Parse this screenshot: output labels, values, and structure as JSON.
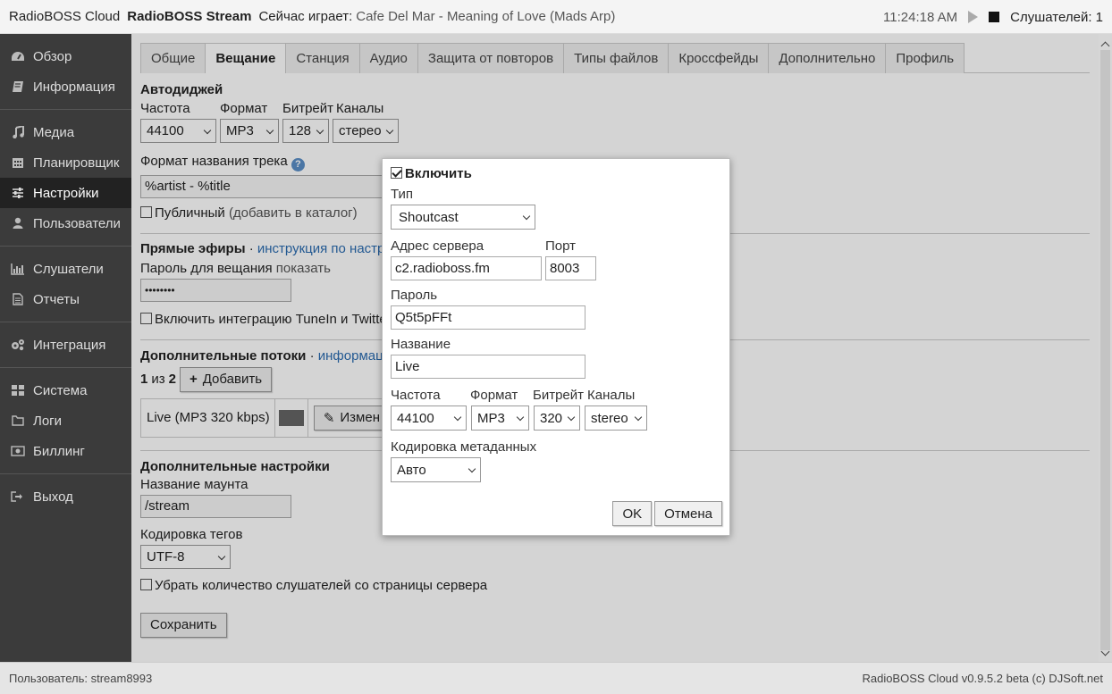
{
  "topbar": {
    "app_name": "RadioBOSS Cloud",
    "station_name": "RadioBOSS Stream",
    "now_playing_label": "Сейчас играет:",
    "now_playing_title": "Cafe Del Mar - Meaning of Love (Mads Arp)",
    "clock": "11:24:18 AM",
    "listeners": "Слушателей: 1"
  },
  "sidebar": {
    "items": [
      {
        "label": "Обзор",
        "icon": "dashboard-icon"
      },
      {
        "label": "Информация",
        "icon": "book-icon"
      },
      {
        "label": "Медиа",
        "icon": "music-icon"
      },
      {
        "label": "Планировщик",
        "icon": "calendar-icon"
      },
      {
        "label": "Настройки",
        "icon": "sliders-icon"
      },
      {
        "label": "Пользователи",
        "icon": "user-icon"
      },
      {
        "label": "Слушатели",
        "icon": "bar-chart-icon"
      },
      {
        "label": "Отчеты",
        "icon": "document-icon"
      },
      {
        "label": "Интеграция",
        "icon": "gears-icon"
      },
      {
        "label": "Система",
        "icon": "grid-icon"
      },
      {
        "label": "Логи",
        "icon": "folder-icon"
      },
      {
        "label": "Биллинг",
        "icon": "money-icon"
      },
      {
        "label": "Выход",
        "icon": "logout-icon"
      }
    ],
    "active": "Настройки"
  },
  "tabs": [
    "Общие",
    "Вещание",
    "Станция",
    "Аудио",
    "Защита от повторов",
    "Типы файлов",
    "Кроссфейды",
    "Дополнительно",
    "Профиль"
  ],
  "active_tab": "Вещание",
  "autodj": {
    "title": "Автодиджей",
    "freq_label": "Частота",
    "format_label": "Формат",
    "bitrate_label": "Битрейт",
    "channels_label": "Каналы",
    "freq": "44100",
    "format": "MP3",
    "bitrate": "128",
    "channels": "стерео",
    "track_format_label": "Формат названия трека",
    "track_format": "%artist - %title",
    "public_label": "Публичный",
    "public_hint": "(добавить в каталог)"
  },
  "live": {
    "title": "Прямые эфиры",
    "link": "инструкция по настро",
    "password_label": "Пароль для вещания",
    "show_label": "показать",
    "password": "••••••••",
    "tunein_label": "Включить интеграцию TuneIn и Twitte"
  },
  "streams": {
    "title": "Дополнительные потоки",
    "link": "информация",
    "count_current": "1",
    "count_of": "из",
    "count_total": "2",
    "add_label": "Добавить",
    "stream_name": "Live (MP3 320 kbps)",
    "edit_label": "Измен"
  },
  "extra": {
    "title": "Дополнительные настройки",
    "mount_label": "Название маунта",
    "mount": "/stream",
    "encoding_label": "Кодировка тегов",
    "encoding": "UTF-8",
    "hide_listeners_label": "Убрать количество слушателей со страницы сервера",
    "save_label": "Сохранить"
  },
  "dialog": {
    "enable_label": "Включить",
    "type_label": "Тип",
    "type": "Shoutcast",
    "server_label": "Адрес сервера",
    "server": "c2.radioboss.fm",
    "port_label": "Порт",
    "port": "8003",
    "password_label": "Пароль",
    "password": "Q5t5pFFt",
    "name_label": "Название",
    "name": "Live",
    "freq_label": "Частота",
    "format_label": "Формат",
    "bitrate_label": "Битрейт",
    "channels_label": "Каналы",
    "freq": "44100",
    "format": "MP3",
    "bitrate": "320",
    "channels": "stereo",
    "meta_encoding_label": "Кодировка метаданных",
    "meta_encoding": "Авто",
    "ok_label": "OK",
    "cancel_label": "Отмена"
  },
  "footer": {
    "user": "Пользователь: stream8993",
    "version": "RadioBOSS Cloud v0.9.5.2 beta (c) DJSoft.net"
  },
  "colors": {
    "sidebar_bg": "#3b3b3b",
    "sidebar_active": "#222222",
    "link": "#2b6cb0",
    "help": "#5b8fc7"
  }
}
